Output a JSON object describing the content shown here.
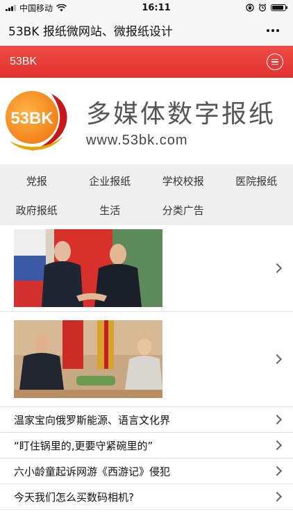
{
  "status_bar": {
    "carrier": "中国移动",
    "time": "16:11"
  },
  "title_bar": {
    "title": "53BK 报纸微网站、微报纸设计"
  },
  "header": {
    "brand": "53BK"
  },
  "banner": {
    "logo_text": "53BK",
    "title": "多媒体数字报纸",
    "url": "www.53bk.com"
  },
  "nav": {
    "items": [
      "党报",
      "企业报纸",
      "学校校报",
      "医院报纸",
      "政府报纸",
      "生活",
      "分类广告"
    ]
  },
  "news": [
    {
      "text": "温家宝向俄罗斯能源、语言文化界"
    },
    {
      "text": "“盯住锅里的,更要守紧碗里的”"
    },
    {
      "text": "六小龄童起诉网游《西游记》侵犯"
    },
    {
      "text": "今天我们怎么买数码相机?"
    }
  ],
  "colors": {
    "accent_red": "#e53b37",
    "nav_bg": "#efefef"
  }
}
